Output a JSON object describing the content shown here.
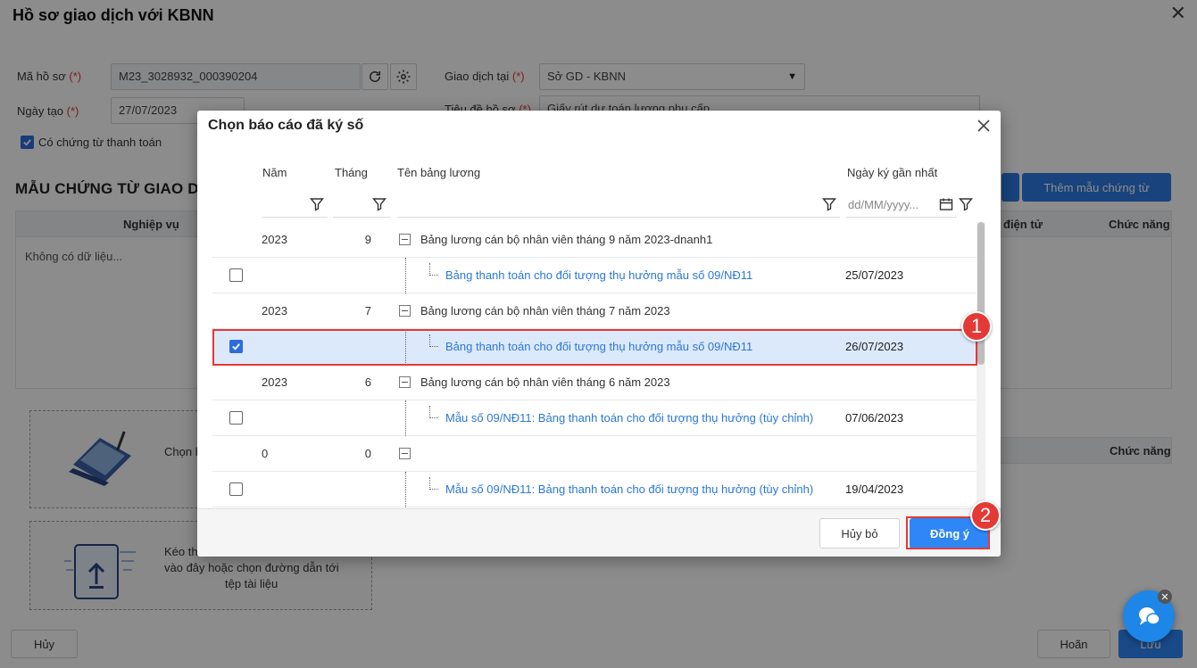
{
  "page": {
    "title": "Hồ sơ giao dịch với KBNN",
    "form": {
      "ma_ho_so_label": "Mã hồ sơ",
      "required_mark": "(*)",
      "ma_ho_so_value": "M23_3028932_000390204",
      "ngay_tao_label": "Ngày tạo",
      "ngay_tao_value": "27/07/2023",
      "giao_dich_tai_label": "Giao dịch tại",
      "giao_dich_tai_value": "Sở GD - KBNN",
      "tieu_de_label": "Tiêu đề hồ sơ",
      "tieu_de_value": "Giấy rút dự toán lương phụ cấp",
      "co_chung_tu_label": "Có chứng từ thanh toán"
    },
    "section_title": "MẪU CHỨNG TỪ GIAO DỊ",
    "them_mau_button": "Thêm mẫu chứng từ",
    "grid1_headers": {
      "nghiep_vu": "Nghiệp vụ",
      "dien_tu": "điện tử",
      "chuc_nang": "Chức năng"
    },
    "no_data": "Không có dữ liệu...",
    "grid2_chuc_nang": "Chức năng",
    "dropzone1_text": "Chọn b",
    "dropzone2_text_1": "Kéo th",
    "dropzone2_text_2": "vào đây hoặc chọn đường dẫn tới",
    "dropzone2_text_3": "tệp tài liệu",
    "footer": {
      "huy": "Hủy",
      "hoan": "Hoãn",
      "luu": "Lưu"
    }
  },
  "dialog": {
    "title": "Chọn báo cáo đã ký số",
    "columns": {
      "nam": "Năm",
      "thang": "Tháng",
      "ten_bang_luong": "Tên bảng lương",
      "ngay_ky": "Ngày ký gần nhất"
    },
    "date_placeholder": "dd/MM/yyyy...",
    "rows": [
      {
        "type": "group",
        "nam": "2023",
        "thang": "9",
        "ten": "Bảng lương cán bộ nhân viên tháng 9 năm 2023-dnanh1"
      },
      {
        "type": "child",
        "checked": false,
        "ten": "Bảng thanh toán cho đối tượng thụ hưởng mẫu số 09/NĐ11",
        "ngay": "25/07/2023"
      },
      {
        "type": "group",
        "nam": "2023",
        "thang": "7",
        "ten": "Bảng lương cán bộ nhân viên tháng 7 năm 2023"
      },
      {
        "type": "child",
        "checked": true,
        "ten": "Bảng thanh toán cho đối tượng thụ hưởng mẫu số 09/NĐ11",
        "ngay": "26/07/2023"
      },
      {
        "type": "group",
        "nam": "2023",
        "thang": "6",
        "ten": "Bảng lương cán bộ nhân viên tháng 6 năm 2023"
      },
      {
        "type": "child",
        "checked": false,
        "ten": "Mẫu số 09/NĐ11: Bảng thanh toán cho đối tượng thụ hưởng (tùy chỉnh)",
        "ngay": "07/06/2023"
      },
      {
        "type": "group",
        "nam": "0",
        "thang": "0",
        "ten": ""
      },
      {
        "type": "child",
        "checked": false,
        "ten": "Mẫu số 09/NĐ11: Bảng thanh toán cho đối tượng thụ hưởng (tùy chỉnh)",
        "ngay": "19/04/2023"
      }
    ],
    "cancel_button": "Hủy bỏ",
    "ok_button": "Đồng ý"
  },
  "annotations": {
    "step1": "1",
    "step2": "2"
  },
  "colors": {
    "accent": "#2f86f6",
    "highlight": "#e53935",
    "selected_row": "#dce9fb",
    "link": "#2b78d6"
  }
}
